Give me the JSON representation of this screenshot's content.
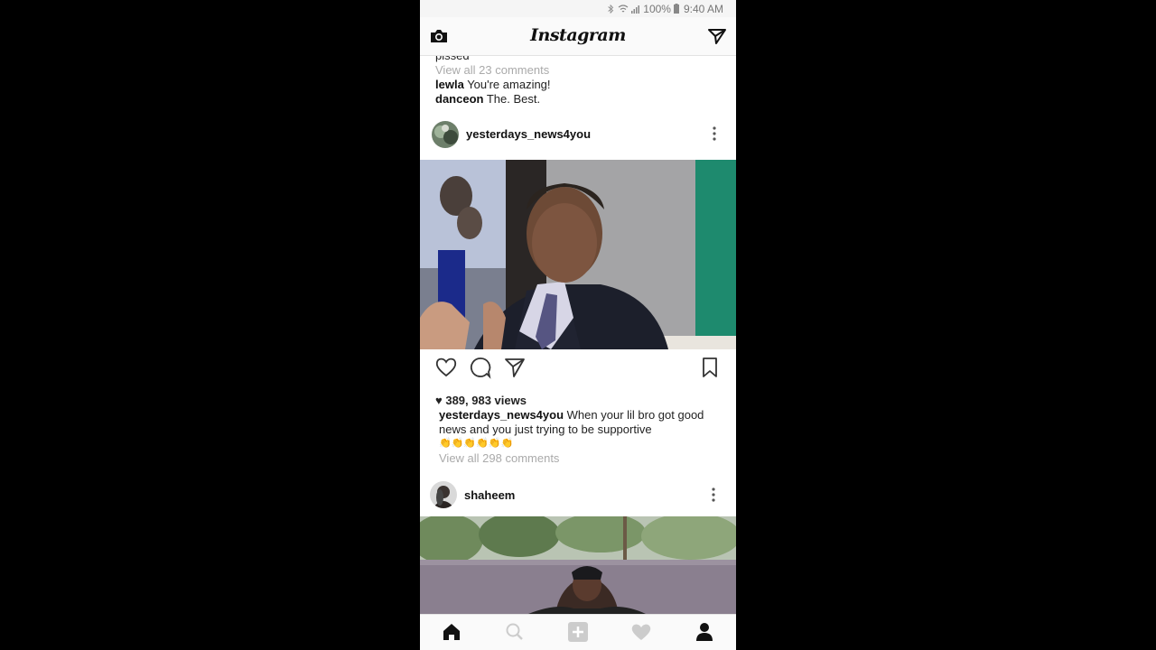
{
  "status_bar": {
    "battery": "100%",
    "time": "9:40 AM"
  },
  "app": {
    "title": "Instagram"
  },
  "prev_post": {
    "cut_off_text": "pissed",
    "view_all": "View all 23 comments",
    "comments": [
      {
        "user": "lewla",
        "text": "You're amazing!"
      },
      {
        "user": "danceon",
        "text": "The. Best."
      }
    ]
  },
  "post1": {
    "username": "yesterdays_news4you",
    "views": "389, 983 views",
    "caption_user": "yesterdays_news4you",
    "caption_line1": "When your lil bro got good",
    "caption_line2": "news and you just trying to be supportive",
    "caption_emoji": "👏👏👏👏👏👏",
    "view_all": "View all 298 comments"
  },
  "post2": {
    "username": "shaheem"
  },
  "icons": {
    "camera": "camera-icon",
    "direct": "direct-message-icon",
    "like": "heart-icon",
    "comment": "comment-icon",
    "share": "send-icon",
    "save": "bookmark-icon",
    "more": "more-vertical-icon",
    "nav": [
      "home-icon",
      "search-icon",
      "add-post-icon",
      "activity-heart-icon",
      "profile-icon"
    ]
  },
  "colors": {
    "accent_text": "#111111",
    "muted_text": "#aaaaaa",
    "topbar_bg": "#fafafa"
  }
}
